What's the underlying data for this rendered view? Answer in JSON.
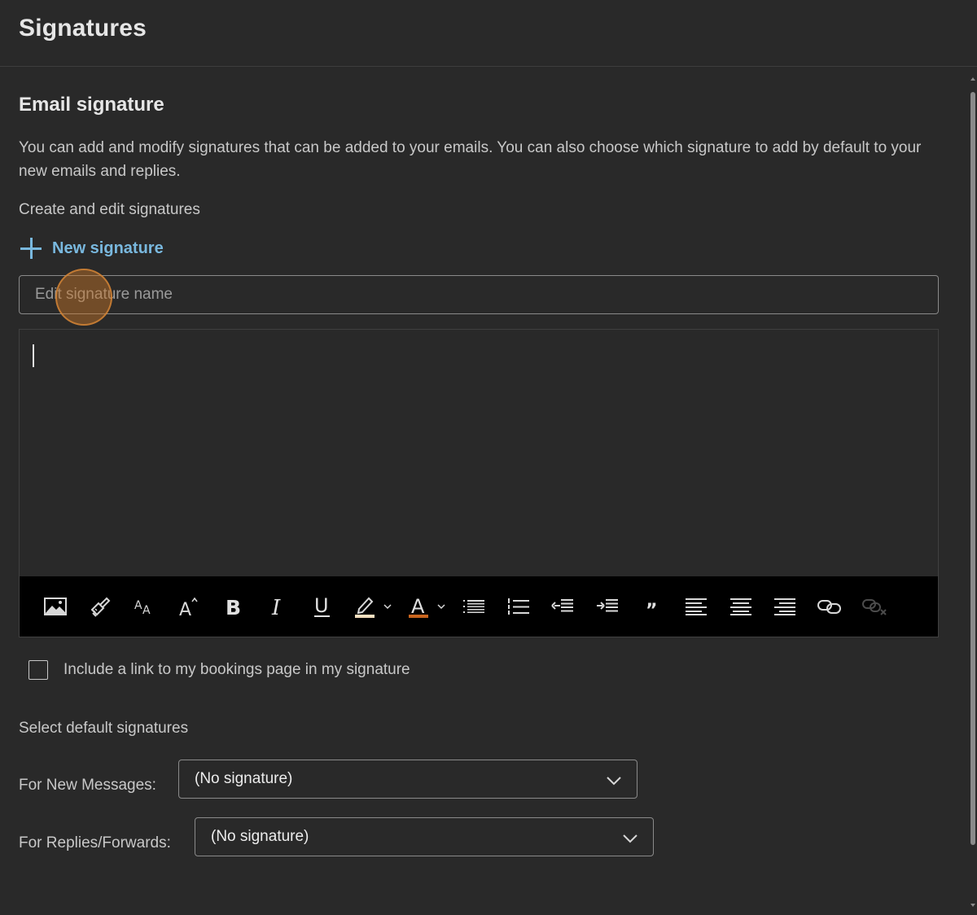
{
  "header": {
    "title": "Signatures"
  },
  "section": {
    "title": "Email signature",
    "description": "You can add and modify signatures that can be added to your emails. You can also choose which signature to add by default to your new emails and replies.",
    "create_label": "Create and edit signatures",
    "new_signature_label": "New signature"
  },
  "signature_name": {
    "placeholder": "Edit signature name",
    "value": ""
  },
  "editor": {
    "body": "",
    "toolbar": [
      {
        "name": "insert-picture",
        "icon": "picture-icon"
      },
      {
        "name": "format-painter",
        "icon": "format-painter-icon"
      },
      {
        "name": "font-size",
        "icon": "font-size-icon"
      },
      {
        "name": "grow-font",
        "icon": "grow-font-icon"
      },
      {
        "name": "bold",
        "icon": "bold-icon"
      },
      {
        "name": "italic",
        "icon": "italic-icon"
      },
      {
        "name": "underline",
        "icon": "underline-icon"
      },
      {
        "name": "highlight",
        "icon": "highlighter-icon",
        "dropdown": true
      },
      {
        "name": "font-color",
        "icon": "font-color-icon",
        "dropdown": true
      },
      {
        "name": "bullets",
        "icon": "bulleted-list-icon"
      },
      {
        "name": "numbering",
        "icon": "numbered-list-icon"
      },
      {
        "name": "decrease-indent",
        "icon": "decrease-indent-icon"
      },
      {
        "name": "increase-indent",
        "icon": "increase-indent-icon"
      },
      {
        "name": "quote",
        "icon": "quote-icon"
      },
      {
        "name": "align-left",
        "icon": "align-left-icon"
      },
      {
        "name": "align-center",
        "icon": "align-center-icon"
      },
      {
        "name": "align-right",
        "icon": "align-right-icon"
      },
      {
        "name": "insert-link",
        "icon": "link-icon"
      },
      {
        "name": "remove-link",
        "icon": "unlink-icon",
        "disabled": true
      }
    ],
    "highlight_color": "#f5e0c0",
    "font_color": "#c8641e"
  },
  "bookings": {
    "label": "Include a link to my bookings page in my signature",
    "checked": false
  },
  "defaults": {
    "title": "Select default signatures",
    "new_messages": {
      "label": "For New Messages:",
      "value": "(No signature)"
    },
    "replies_forwards": {
      "label": "For Replies/Forwards:",
      "value": "(No signature)"
    }
  },
  "colors": {
    "background": "#292929",
    "accent": "#79b8de",
    "toolbar": "#000000",
    "click_marker": "#cd7828"
  }
}
